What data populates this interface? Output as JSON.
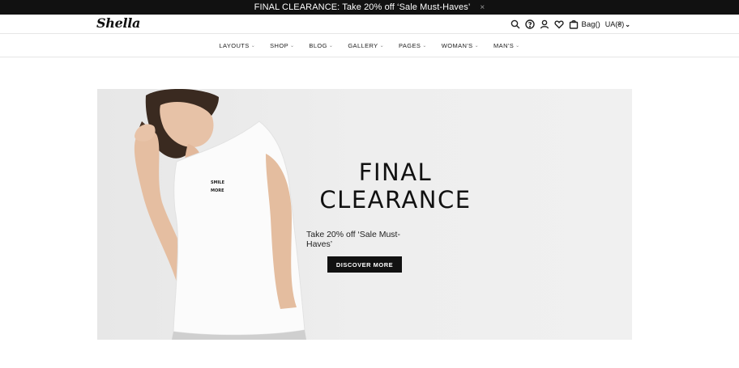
{
  "announcement": {
    "text": "FINAL CLEARANCE: Take 20% off ‘Sale Must-Haves’",
    "close": "×"
  },
  "header": {
    "logo": "Shella",
    "icons": [
      "search-icon",
      "help-icon",
      "user-icon",
      "heart-icon",
      "bag-icon"
    ],
    "bag_label": "Bag()",
    "currency": "UA(₴)"
  },
  "nav": {
    "items": [
      {
        "label": "LAYOUTS"
      },
      {
        "label": "SHOP"
      },
      {
        "label": "BLOG"
      },
      {
        "label": "GALLERY"
      },
      {
        "label": "PAGES"
      },
      {
        "label": "WOMAN'S"
      },
      {
        "label": "MAN'S"
      }
    ]
  },
  "hero": {
    "title_line1": "FINAL",
    "title_line2": "CLEARANCE",
    "subtitle": "Take 20% off ‘Sale Must-Haves’",
    "button": "DISCOVER MORE",
    "shirt_text_1": "SMILE",
    "shirt_text_2": "MORE"
  }
}
